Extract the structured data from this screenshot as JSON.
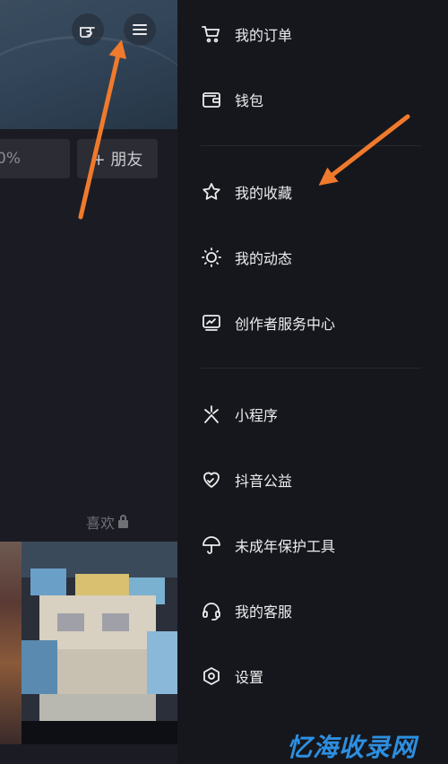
{
  "left_panel": {
    "field_text": "0%",
    "friend_button": "+ 朋友",
    "likes_label": "喜欢"
  },
  "drawer": {
    "items": [
      {
        "label": "我的订单",
        "icon": "cart-icon"
      },
      {
        "label": "钱包",
        "icon": "wallet-icon"
      },
      {
        "label": "我的收藏",
        "icon": "star-icon"
      },
      {
        "label": "我的动态",
        "icon": "sun-icon"
      },
      {
        "label": "创作者服务中心",
        "icon": "chart-monitor-icon"
      },
      {
        "label": "小程序",
        "icon": "mini-program-icon"
      },
      {
        "label": "抖音公益",
        "icon": "heart-icon"
      },
      {
        "label": "未成年保护工具",
        "icon": "umbrella-icon"
      },
      {
        "label": "我的客服",
        "icon": "headset-icon"
      },
      {
        "label": "设置",
        "icon": "hexagon-settings-icon"
      }
    ]
  },
  "watermark": "忆海收录网",
  "colors": {
    "background": "#16171d",
    "text": "#eceded",
    "arrow": "#f07a2c",
    "watermark": "#2d8fe0"
  }
}
